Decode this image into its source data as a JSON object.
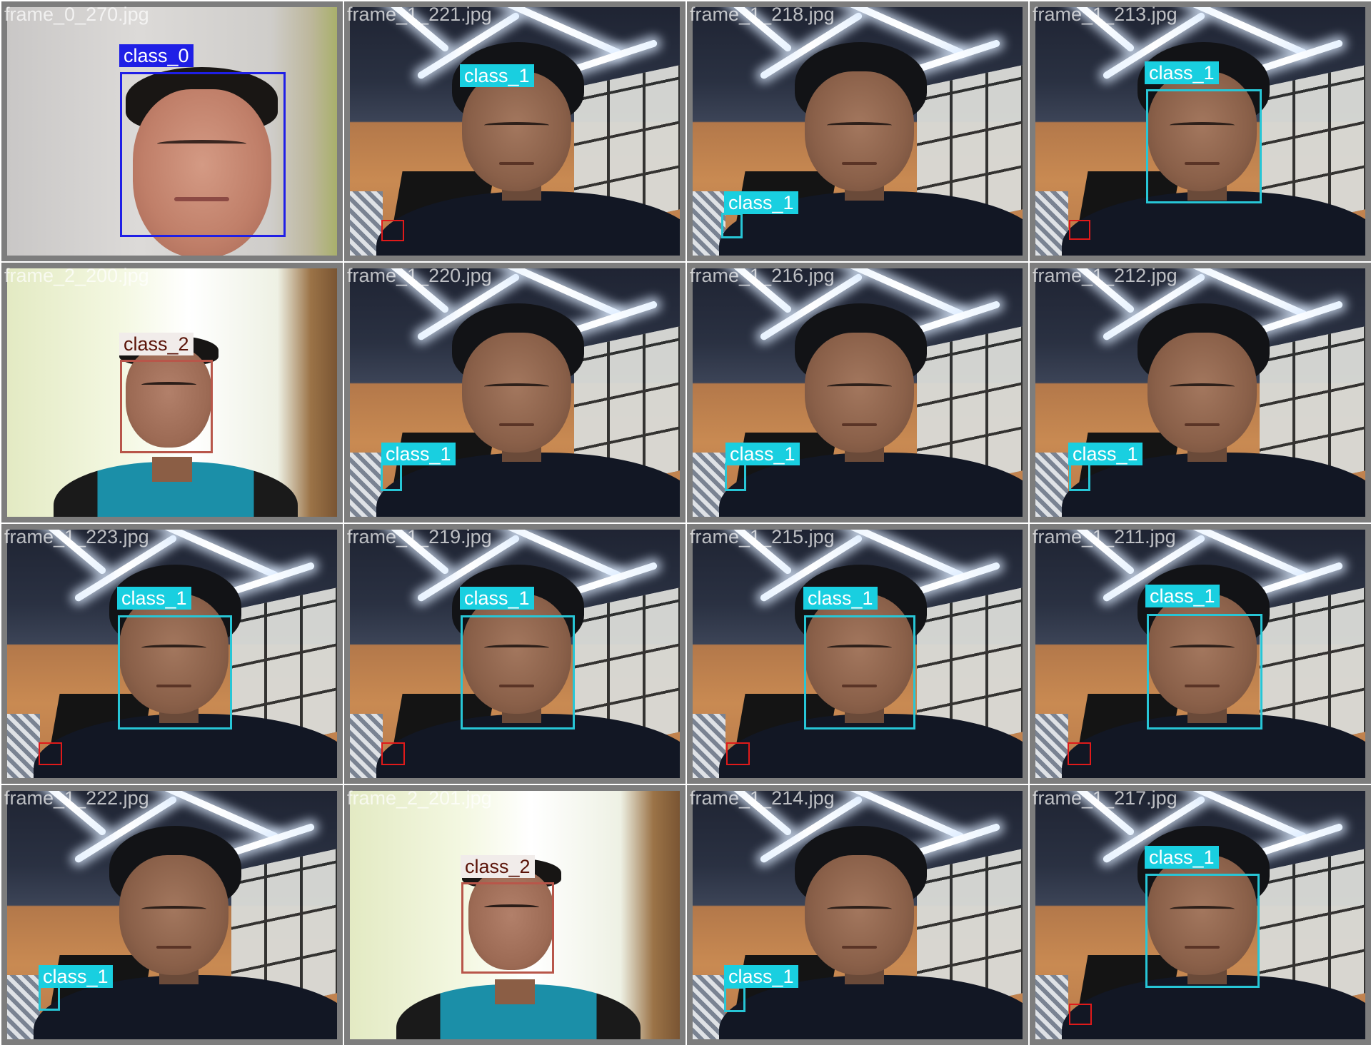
{
  "grid": {
    "tiles": [
      {
        "filename": "frame_0_270.jpg",
        "scene": "gray",
        "detections": [
          {
            "label": "class_0",
            "cls": "c0"
          }
        ]
      },
      {
        "filename": "frame_1_221.jpg",
        "scene": "room",
        "detections": [
          {
            "label": "class_1",
            "cls": "c1"
          },
          {
            "label": "",
            "cls": "c3"
          }
        ]
      },
      {
        "filename": "frame_1_218.jpg",
        "scene": "room",
        "detections": [
          {
            "label": "class_1",
            "cls": "c1"
          }
        ]
      },
      {
        "filename": "frame_1_213.jpg",
        "scene": "room",
        "detections": [
          {
            "label": "class_1",
            "cls": "c1"
          },
          {
            "label": "",
            "cls": "c3"
          }
        ]
      },
      {
        "filename": "frame_2_200.jpg",
        "scene": "bright",
        "detections": [
          {
            "label": "class_2",
            "cls": "c2"
          }
        ]
      },
      {
        "filename": "frame_1_220.jpg",
        "scene": "room",
        "detections": [
          {
            "label": "class_1",
            "cls": "c1"
          }
        ]
      },
      {
        "filename": "frame_1_216.jpg",
        "scene": "room",
        "detections": [
          {
            "label": "class_1",
            "cls": "c1"
          }
        ]
      },
      {
        "filename": "frame_1_212.jpg",
        "scene": "room",
        "detections": [
          {
            "label": "class_1",
            "cls": "c1"
          }
        ]
      },
      {
        "filename": "frame_1_223.jpg",
        "scene": "room",
        "detections": [
          {
            "label": "class_1",
            "cls": "c1"
          },
          {
            "label": "",
            "cls": "c3"
          }
        ]
      },
      {
        "filename": "frame_1_219.jpg",
        "scene": "room",
        "detections": [
          {
            "label": "class_1",
            "cls": "c1"
          },
          {
            "label": "",
            "cls": "c3"
          }
        ]
      },
      {
        "filename": "frame_1_215.jpg",
        "scene": "room",
        "detections": [
          {
            "label": "class_1",
            "cls": "c1"
          },
          {
            "label": "",
            "cls": "c3"
          }
        ]
      },
      {
        "filename": "frame_1_211.jpg",
        "scene": "room",
        "detections": [
          {
            "label": "class_1",
            "cls": "c1"
          },
          {
            "label": "",
            "cls": "c3"
          }
        ]
      },
      {
        "filename": "frame_1_222.jpg",
        "scene": "room",
        "detections": [
          {
            "label": "class_1",
            "cls": "c1"
          }
        ]
      },
      {
        "filename": "frame_2_201.jpg",
        "scene": "bright",
        "detections": [
          {
            "label": "class_2",
            "cls": "c2"
          }
        ]
      },
      {
        "filename": "frame_1_214.jpg",
        "scene": "room",
        "detections": [
          {
            "label": "class_1",
            "cls": "c1"
          }
        ]
      },
      {
        "filename": "frame_1_217.jpg",
        "scene": "room",
        "detections": [
          {
            "label": "class_1",
            "cls": "c1"
          },
          {
            "label": "",
            "cls": "c3"
          }
        ]
      }
    ]
  },
  "colors": {
    "class_0": "#1f1fe6",
    "class_1": "#19cfe0",
    "class_2": "#f1ecea",
    "unlabeled_box": "#e01a1a",
    "frame_border": "#7d7d7d"
  }
}
